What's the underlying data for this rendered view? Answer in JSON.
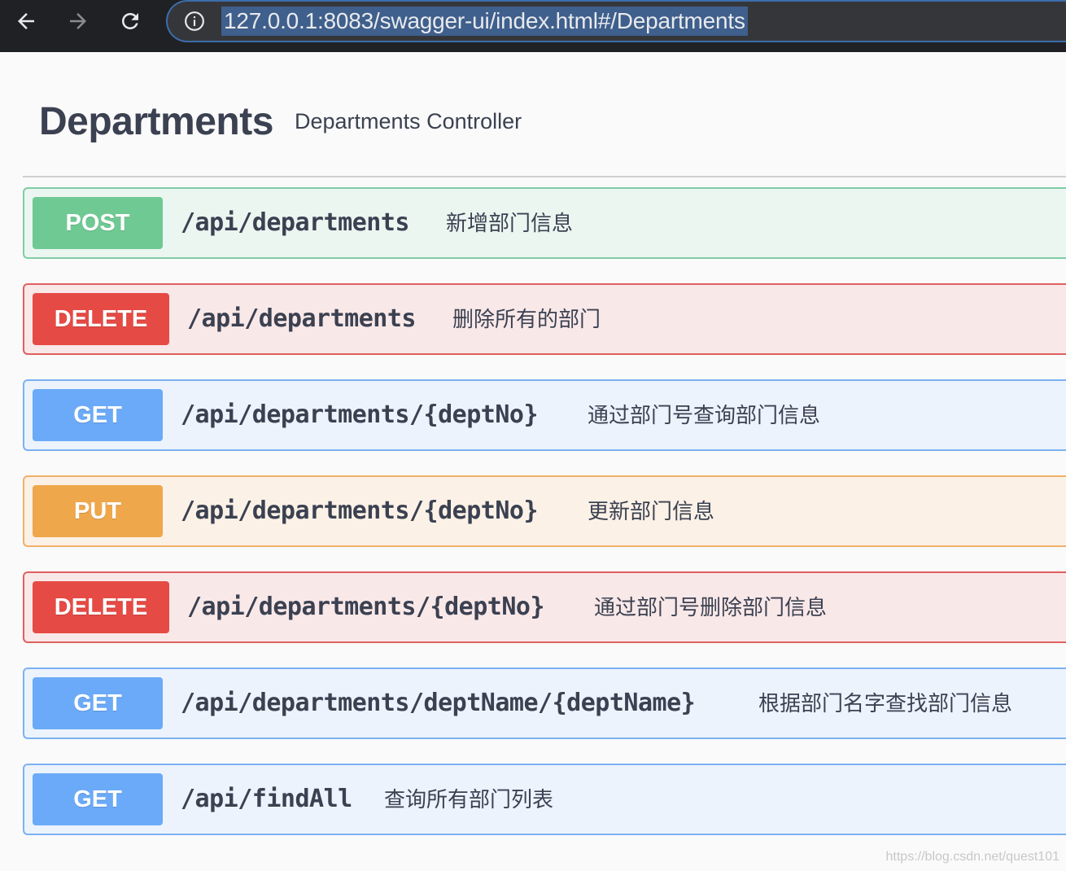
{
  "browser": {
    "url": "127.0.0.1:8083/swagger-ui/index.html#/Departments",
    "colors": {
      "toolbar": "#202124",
      "omnibox": "#35363a",
      "selection": "#3f5f8c"
    }
  },
  "tag": {
    "name": "Departments",
    "description": "Departments Controller"
  },
  "operations": [
    {
      "method": "POST",
      "path": "/api/departments",
      "summary": "新增部门信息"
    },
    {
      "method": "DELETE",
      "path": "/api/departments",
      "summary": "删除所有的部门"
    },
    {
      "method": "GET",
      "path": "/api/departments/{deptNo}",
      "summary": "通过部门号查询部门信息"
    },
    {
      "method": "PUT",
      "path": "/api/departments/{deptNo}",
      "summary": "更新部门信息"
    },
    {
      "method": "DELETE",
      "path": "/api/departments/{deptNo}",
      "summary": "通过部门号删除部门信息"
    },
    {
      "method": "GET",
      "path": "/api/departments/deptName/{deptName}",
      "summary": "根据部门名字查找部门信息"
    },
    {
      "method": "GET",
      "path": "/api/findAll",
      "summary": "查询所有部门列表"
    }
  ],
  "method_colors": {
    "POST": "#6fc993",
    "DELETE": "#e64a45",
    "GET": "#6aaaf8",
    "PUT": "#efa74c"
  },
  "watermark": "https://blog.csdn.net/quest101"
}
